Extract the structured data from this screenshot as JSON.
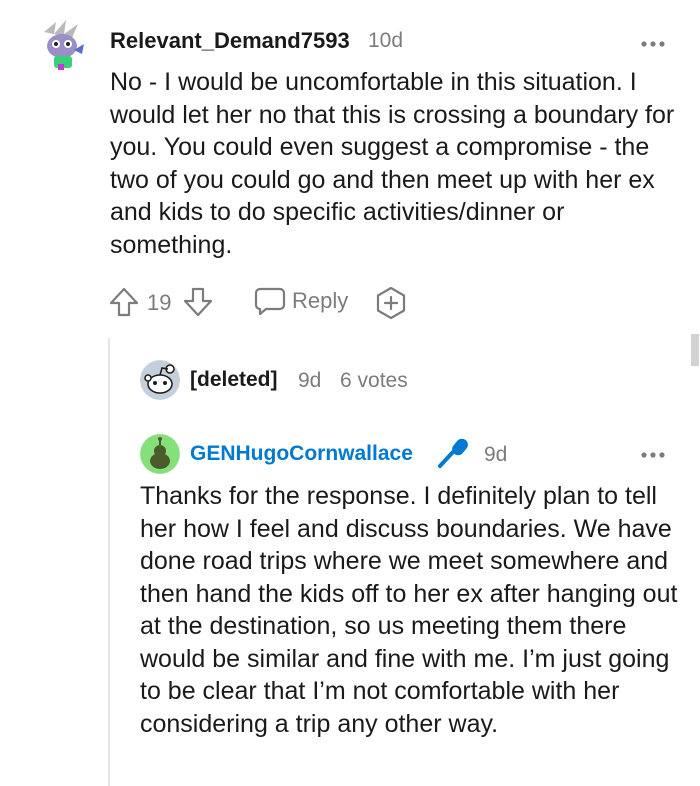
{
  "comment1": {
    "username": "Relevant_Demand7593",
    "age": "10d",
    "more_icon": "more-dots-icon",
    "body": "No - I would be uncomfortable in this situation. I would let her no that this is crossing a boundary for you. You could even suggest a compromise - the two of you could go and then meet up with her ex and kids to do specific activities/dinner or something.",
    "upvote_icon": "upvote-arrow-icon",
    "vote_count": "19",
    "downvote_icon": "downvote-arrow-icon",
    "reply_label": "Reply",
    "reply_icon": "speech-bubble-icon",
    "award_icon": "plus-award-icon"
  },
  "collapsed_reply": {
    "username": "[deleted]",
    "age": "9d",
    "votes": "6 votes"
  },
  "comment2": {
    "username": "GENHugoCornwallace",
    "badge_icon": "microphone-icon",
    "age": "9d",
    "more_icon": "more-dots-icon",
    "body": "Thanks for the response. I definitely plan to tell her how I feel and discuss boundaries. We have done road trips where we meet somewhere and then hand the kids off to her ex after hanging out at the destination, so us meeting them there would be similar and fine with me. I’m just going to be clear that I’m not comfortable with her considering a trip any other way."
  },
  "colors": {
    "op_username": "#0079d3",
    "mic_badge": "#0079d3",
    "text": "#1a1a1b",
    "meta": "#7c7c7c"
  }
}
